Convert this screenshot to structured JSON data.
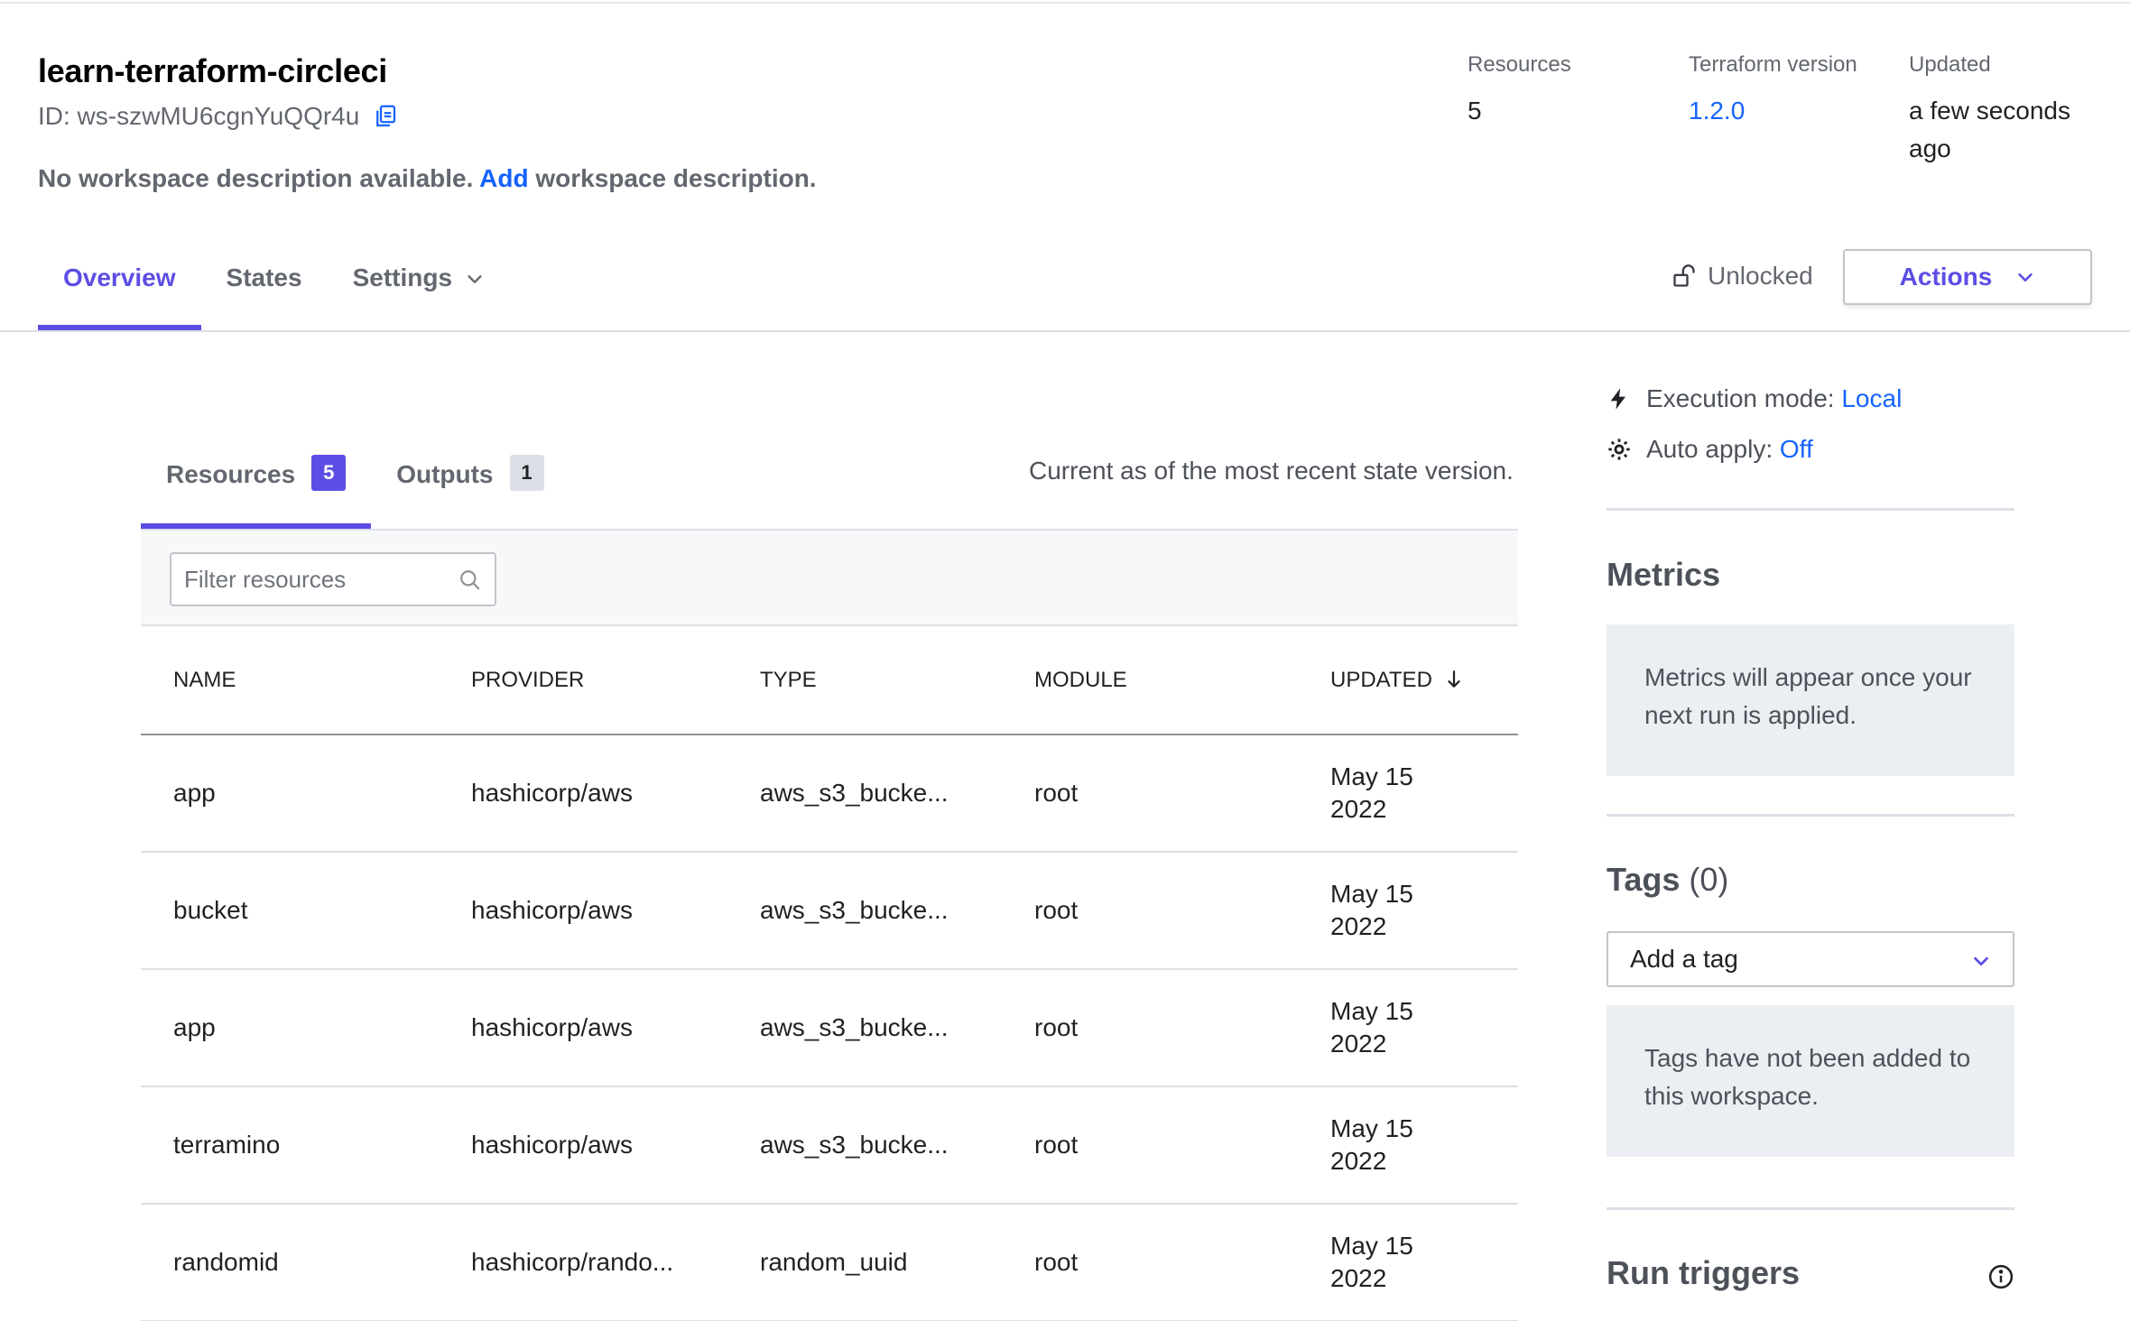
{
  "workspace": {
    "name": "learn-terraform-circleci",
    "id_text": "ID: ws-szwMU6cgnYuQQr4u",
    "desc_before": "No workspace description available.",
    "desc_link": "Add",
    "desc_after": "workspace description."
  },
  "meta": {
    "resources_label": "Resources",
    "resources_value": "5",
    "tf_label": "Terraform version",
    "tf_value": "1.2.0",
    "updated_label": "Updated",
    "updated_line1": "a few seconds",
    "updated_line2": "ago"
  },
  "nav": {
    "overview": "Overview",
    "states": "States",
    "settings": "Settings",
    "lock_status": "Unlocked",
    "actions": "Actions"
  },
  "subtabs": {
    "resources_label": "Resources",
    "resources_count": "5",
    "outputs_label": "Outputs",
    "outputs_count": "1",
    "current_as_of": "Current as of the most recent state version."
  },
  "filter": {
    "placeholder": "Filter resources"
  },
  "table": {
    "headers": {
      "name": "NAME",
      "provider": "PROVIDER",
      "type": "TYPE",
      "module": "MODULE",
      "updated": "UPDATED"
    },
    "rows": [
      {
        "name": "app",
        "provider": "hashicorp/aws",
        "type": "aws_s3_bucke...",
        "module": "root",
        "date1": "May 15",
        "date2": "2022"
      },
      {
        "name": "bucket",
        "provider": "hashicorp/aws",
        "type": "aws_s3_bucke...",
        "module": "root",
        "date1": "May 15",
        "date2": "2022"
      },
      {
        "name": "app",
        "provider": "hashicorp/aws",
        "type": "aws_s3_bucke...",
        "module": "root",
        "date1": "May 15",
        "date2": "2022"
      },
      {
        "name": "terramino",
        "provider": "hashicorp/aws",
        "type": "aws_s3_bucke...",
        "module": "root",
        "date1": "May 15",
        "date2": "2022"
      },
      {
        "name": "randomid",
        "provider": "hashicorp/rando...",
        "type": "random_uuid",
        "module": "root",
        "date1": "May 15",
        "date2": "2022"
      }
    ]
  },
  "sidebar": {
    "exec_label": "Execution mode:",
    "exec_value": "Local",
    "auto_label": "Auto apply:",
    "auto_value": "Off",
    "metrics_heading": "Metrics",
    "metrics_text": "Metrics will appear once your next run is applied.",
    "tags_heading": "Tags",
    "tags_count": "(0)",
    "tag_select": "Add a tag",
    "tags_text": "Tags have not been added to this workspace.",
    "run_triggers_heading": "Run triggers"
  },
  "colors": {
    "accent": "#5c4ee5",
    "link": "#1563ff"
  }
}
